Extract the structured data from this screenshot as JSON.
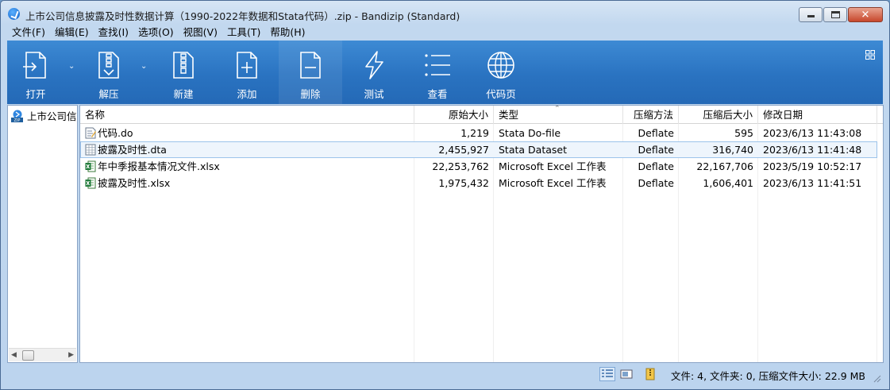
{
  "window": {
    "title": "上市公司信息披露及时性数据计算（1990-2022年数据和Stata代码）.zip - Bandizip (Standard)"
  },
  "menu": [
    "文件(F)",
    "编辑(E)",
    "查找(I)",
    "选项(O)",
    "视图(V)",
    "工具(T)",
    "帮助(H)"
  ],
  "toolbar": {
    "open": "打开",
    "extract": "解压",
    "new": "新建",
    "add": "添加",
    "delete": "删除",
    "test": "测试",
    "view": "查看",
    "codepage": "代码页"
  },
  "tree": {
    "root_label": "上市公司信"
  },
  "columns": {
    "name": "名称",
    "original_size": "原始大小",
    "type": "类型",
    "method": "压缩方法",
    "compressed_size": "压缩后大小",
    "modified": "修改日期"
  },
  "files": [
    {
      "name": "代码.do",
      "original_size": "1,219",
      "type": "Stata Do-file",
      "method": "Deflate",
      "compressed_size": "595",
      "modified": "2023/6/13 11:43:08",
      "icon": "do-file-icon"
    },
    {
      "name": "披露及时性.dta",
      "original_size": "2,455,927",
      "type": "Stata Dataset",
      "method": "Deflate",
      "compressed_size": "316,740",
      "modified": "2023/6/13 11:41:48",
      "icon": "dta-file-icon"
    },
    {
      "name": "年中季报基本情况文件.xlsx",
      "original_size": "22,253,762",
      "type": "Microsoft Excel 工作表",
      "method": "Deflate",
      "compressed_size": "22,167,706",
      "modified": "2023/5/19 10:52:17",
      "icon": "excel-file-icon"
    },
    {
      "name": "披露及时性.xlsx",
      "original_size": "1,975,432",
      "type": "Microsoft Excel 工作表",
      "method": "Deflate",
      "compressed_size": "1,606,401",
      "modified": "2023/6/13 11:41:51",
      "icon": "excel-file-icon"
    }
  ],
  "status": {
    "summary": "文件: 4, 文件夹: 0, 压缩文件大小: 22.9 MB"
  },
  "colors": {
    "toolbar": "#2a73c1",
    "selection": "#eef5fc",
    "selection_border": "#9cc3ea"
  }
}
